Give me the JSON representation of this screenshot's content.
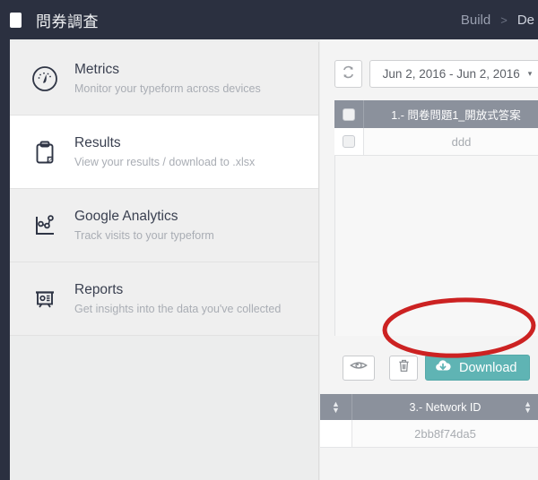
{
  "topbar": {
    "form_icon_name": "form-document-icon",
    "title": "問券調査",
    "breadcrumb": [
      {
        "label": "Build",
        "active": false
      },
      {
        "label": ">",
        "active": false
      },
      {
        "label": "De",
        "active": true
      }
    ]
  },
  "sidebar": {
    "items": [
      {
        "icon": "gauge-icon",
        "title": "Metrics",
        "subtitle": "Monitor your typeform across devices",
        "active": false
      },
      {
        "icon": "clipboard-icon",
        "title": "Results",
        "subtitle": "View your results / download to .xlsx",
        "active": true
      },
      {
        "icon": "analytics-chart-icon",
        "title": "Google Analytics",
        "subtitle": "Track visits to your typeform",
        "active": false
      },
      {
        "icon": "presentation-board-icon",
        "title": "Reports",
        "subtitle": "Get insights into the data you've collected",
        "active": false
      }
    ]
  },
  "toolbar": {
    "refresh_icon": "refresh-icon",
    "date_range": "Jun 2, 2016 - Jun 2, 2016",
    "caret": "▾"
  },
  "table_primary": {
    "columns": [
      "1.- 問卷問題1_開放式答案"
    ],
    "rows": [
      {
        "checked": false,
        "values": [
          "ddd"
        ]
      }
    ],
    "sort_up": "▲",
    "sort_down": "▼"
  },
  "actions": {
    "preview_icon": "eye-icon",
    "delete_icon": "trash-icon",
    "download_icon": "cloud-download-icon",
    "download_label": "Download"
  },
  "table_secondary": {
    "columns": [
      "3.- Network ID"
    ],
    "rows": [
      {
        "values": [
          "2bb8f74da5"
        ]
      }
    ],
    "sort_up": "▲",
    "sort_down": "▼"
  },
  "annotation": {
    "type": "ellipse-highlight",
    "color": "#cc2222",
    "target": "Download"
  },
  "colors": {
    "header_bg": "#2b3040",
    "table_header_bg": "#8b919c",
    "download_teal": "#5fb4b4",
    "annotation_red": "#cc2222",
    "panel_bg": "#eceded",
    "sidebar_bg": "#efefef"
  }
}
